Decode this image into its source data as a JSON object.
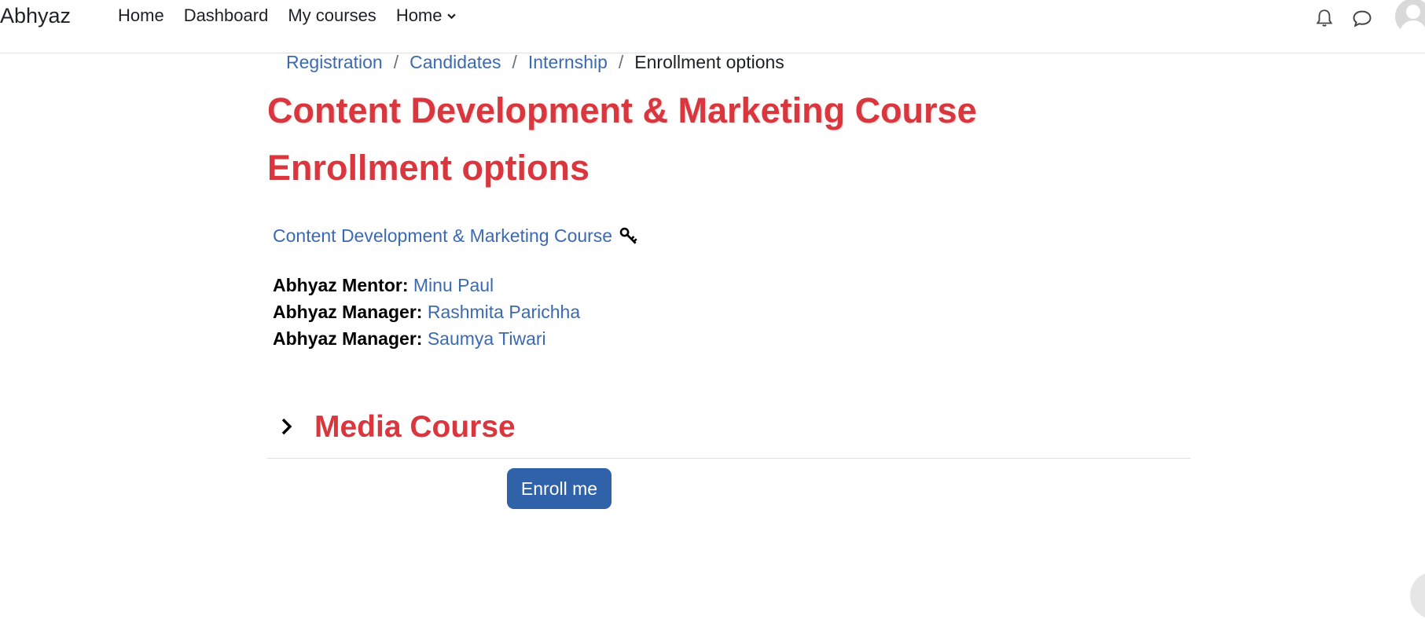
{
  "brand": "Abhyaz",
  "nav": [
    {
      "label": "Home"
    },
    {
      "label": "Dashboard"
    },
    {
      "label": "My courses"
    },
    {
      "label": "Home"
    }
  ],
  "header_icons": {
    "notifications": "bell-icon",
    "messages": "chat-bubble-icon",
    "user": "user-avatar"
  },
  "breadcrumb": [
    {
      "label": "Registration"
    },
    {
      "label": "Candidates"
    },
    {
      "label": "Internship"
    },
    {
      "label": "Enrollment options"
    }
  ],
  "breadcrumb_sep": "/",
  "page": {
    "title": "Content Development & Marketing Course",
    "subtitle": "Enrollment options"
  },
  "course": {
    "name": "Content Development & Marketing Course",
    "icon": "key-icon",
    "contacts": [
      {
        "role": "Abhyaz Mentor:",
        "name": "Minu Paul"
      },
      {
        "role": "Abhyaz Manager:",
        "name": "Rashmita Parichha"
      },
      {
        "role": "Abhyaz Manager:",
        "name": "Saumya Tiwari"
      }
    ]
  },
  "section": {
    "title": "Media Course"
  },
  "enroll_button": "Enroll me",
  "colors": {
    "accent_red": "#d9363e",
    "link_blue": "#3b6ab0",
    "button_blue": "#2f62a8"
  }
}
